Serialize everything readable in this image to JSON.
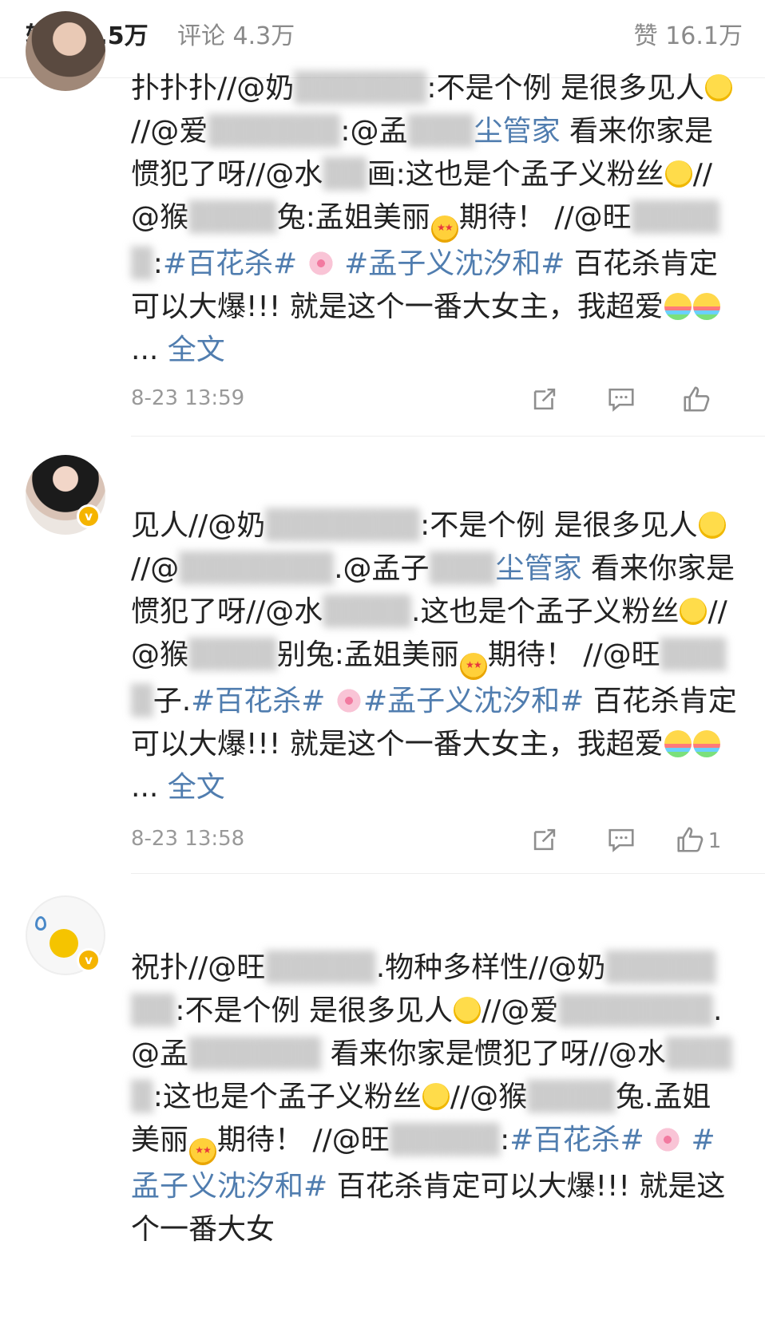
{
  "tabs": {
    "reposts": "转发 5.5万",
    "comments": "评论 4.3万",
    "likes": "赞 16.1万"
  },
  "comments": [
    {
      "username": "",
      "segments": [
        {
          "t": "扑扑扑//@奶",
          "c": "n"
        },
        {
          "t": "▒▒▒▒▒▒",
          "c": "b"
        },
        {
          "t": ":不是个例 是很多见人",
          "c": "n"
        },
        {
          "e": "smile"
        },
        {
          "t": "//@爱",
          "c": "n"
        },
        {
          "t": "▒▒▒▒▒▒",
          "c": "b"
        },
        {
          "t": ":@孟",
          "c": "n"
        },
        {
          "t": "▒▒▒",
          "c": "b"
        },
        {
          "t": "尘管家",
          "c": "l"
        },
        {
          "t": " 看来你家是惯犯了呀//@水",
          "c": "n"
        },
        {
          "t": "▒▒",
          "c": "b"
        },
        {
          "t": "画:这也是个孟子义粉丝",
          "c": "n"
        },
        {
          "e": "smile"
        },
        {
          "t": "//@猴",
          "c": "n"
        },
        {
          "t": "▒▒▒▒",
          "c": "b"
        },
        {
          "t": "兔:孟姐美丽",
          "c": "n"
        },
        {
          "e": "star"
        },
        {
          "t": "期待！ //@旺",
          "c": "n"
        },
        {
          "t": "▒▒▒▒▒",
          "c": "b"
        },
        {
          "t": ":",
          "c": "n"
        },
        {
          "t": "#百花杀#",
          "c": "l"
        },
        {
          "t": " ",
          "c": "n"
        },
        {
          "e": "blossom"
        },
        {
          "t": " #孟子义沈汐和#",
          "c": "l"
        },
        {
          "t": " 百花杀肯定可以大爆!!! 就是这个一番大女主，我超爱",
          "c": "n"
        },
        {
          "e": "rainbow"
        },
        {
          "e": "rainbow"
        },
        {
          "t": "... ",
          "c": "n"
        },
        {
          "t": "全文",
          "c": "m"
        }
      ],
      "time": "8-23 13:59",
      "like_count": ""
    },
    {
      "username": "",
      "segments": [
        {
          "t": "见人//@奶",
          "c": "n"
        },
        {
          "t": "▒▒▒▒▒▒▒",
          "c": "b"
        },
        {
          "t": ":不是个例 是很多见人",
          "c": "n"
        },
        {
          "e": "smile"
        },
        {
          "t": "//@",
          "c": "n"
        },
        {
          "t": "▒▒▒▒▒▒▒",
          "c": "b"
        },
        {
          "t": ".@孟子",
          "c": "n"
        },
        {
          "t": "▒▒▒",
          "c": "b"
        },
        {
          "t": "尘管家",
          "c": "l"
        },
        {
          "t": " 看来你家是惯犯了呀//@水",
          "c": "n"
        },
        {
          "t": "▒▒▒▒",
          "c": "b"
        },
        {
          "t": ".这也是个孟子义粉丝",
          "c": "n"
        },
        {
          "e": "smile"
        },
        {
          "t": "//@猴",
          "c": "n"
        },
        {
          "t": "▒▒▒▒",
          "c": "b"
        },
        {
          "t": "别兔:孟姐美丽",
          "c": "n"
        },
        {
          "e": "star"
        },
        {
          "t": "期待！ //@旺",
          "c": "n"
        },
        {
          "t": "▒▒▒▒",
          "c": "b"
        },
        {
          "t": "子.",
          "c": "n"
        },
        {
          "t": "#百花杀#",
          "c": "l"
        },
        {
          "t": " ",
          "c": "n"
        },
        {
          "e": "blossom"
        },
        {
          "t": "#孟子义沈汐和#",
          "c": "l"
        },
        {
          "t": " 百花杀肯定可以大爆!!! 就是这个一番大女主，我超爱",
          "c": "n"
        },
        {
          "e": "rainbow"
        },
        {
          "e": "rainbow"
        },
        {
          "t": "... ",
          "c": "n"
        },
        {
          "t": "全文",
          "c": "m"
        }
      ],
      "time": "8-23 13:58",
      "like_count": "1"
    },
    {
      "username": "",
      "segments": [
        {
          "t": "祝扑//@旺",
          "c": "n"
        },
        {
          "t": "▒▒▒▒▒",
          "c": "b"
        },
        {
          "t": ".物种多样性//@奶",
          "c": "n"
        },
        {
          "t": "▒▒▒▒▒▒▒",
          "c": "b"
        },
        {
          "t": ":不是个例 是很多见人",
          "c": "n"
        },
        {
          "e": "smile"
        },
        {
          "t": "//@爱",
          "c": "n"
        },
        {
          "t": "▒▒▒▒▒▒▒",
          "c": "b"
        },
        {
          "t": ".@孟",
          "c": "n"
        },
        {
          "t": "▒▒▒▒▒▒",
          "c": "b"
        },
        {
          "t": " 看来你家是惯犯了呀//@水",
          "c": "n"
        },
        {
          "t": "▒▒▒▒",
          "c": "b"
        },
        {
          "t": ":这也是个孟子义粉丝",
          "c": "n"
        },
        {
          "e": "smile"
        },
        {
          "t": "//@猴",
          "c": "n"
        },
        {
          "t": "▒▒▒▒",
          "c": "b"
        },
        {
          "t": "兔.孟姐美丽",
          "c": "n"
        },
        {
          "e": "star"
        },
        {
          "t": "期待！ //@旺",
          "c": "n"
        },
        {
          "t": "▒▒▒▒▒",
          "c": "b"
        },
        {
          "t": ":",
          "c": "n"
        },
        {
          "t": "#百花杀#",
          "c": "l"
        },
        {
          "t": " ",
          "c": "n"
        },
        {
          "e": "blossom"
        },
        {
          "t": " #孟子义沈汐和#",
          "c": "l"
        },
        {
          "t": " 百花杀肯定可以大爆!!! 就是这个一番大女",
          "c": "n"
        }
      ],
      "time": "",
      "like_count": ""
    }
  ],
  "colors": {
    "link": "#507daf",
    "meta": "#999999",
    "verified_badge": "#f5b400"
  }
}
